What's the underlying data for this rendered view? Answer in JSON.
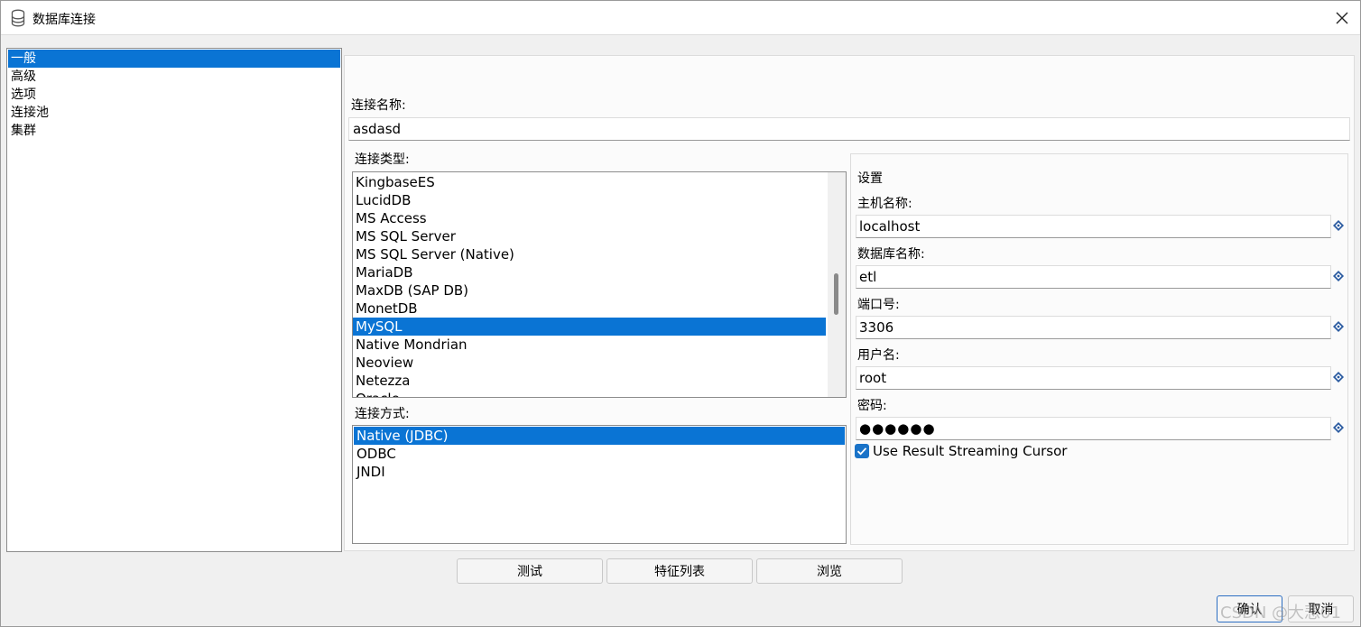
{
  "window": {
    "title": "数据库连接",
    "close_symbol": "✕"
  },
  "nav": {
    "items": [
      {
        "label": "一般",
        "selected": true
      },
      {
        "label": "高级",
        "selected": false
      },
      {
        "label": "选项",
        "selected": false
      },
      {
        "label": "连接池",
        "selected": false
      },
      {
        "label": "集群",
        "selected": false
      }
    ]
  },
  "connection_name": {
    "label": "连接名称:",
    "value": "asdasd"
  },
  "connection_type": {
    "label": "连接类型:",
    "items": [
      {
        "label": "KingbaseES",
        "selected": false
      },
      {
        "label": "LucidDB",
        "selected": false
      },
      {
        "label": "MS Access",
        "selected": false
      },
      {
        "label": "MS SQL Server",
        "selected": false
      },
      {
        "label": "MS SQL Server (Native)",
        "selected": false
      },
      {
        "label": "MariaDB",
        "selected": false
      },
      {
        "label": "MaxDB (SAP DB)",
        "selected": false
      },
      {
        "label": "MonetDB",
        "selected": false
      },
      {
        "label": "MySQL",
        "selected": true
      },
      {
        "label": "Native Mondrian",
        "selected": false
      },
      {
        "label": "Neoview",
        "selected": false
      },
      {
        "label": "Netezza",
        "selected": false
      },
      {
        "label": "Oracle",
        "selected": false
      }
    ]
  },
  "access": {
    "label": "连接方式:",
    "items": [
      {
        "label": "Native (JDBC)",
        "selected": true
      },
      {
        "label": "ODBC",
        "selected": false
      },
      {
        "label": "JNDI",
        "selected": false
      }
    ]
  },
  "settings": {
    "title": "设置",
    "host": {
      "label": "主机名称:",
      "value": "localhost"
    },
    "database": {
      "label": "数据库名称:",
      "value": "etl"
    },
    "port": {
      "label": "端口号:",
      "value": "3306"
    },
    "username": {
      "label": "用户名:",
      "value": "root"
    },
    "password": {
      "label": "密码:",
      "value": "●●●●●●"
    },
    "streaming_cursor": {
      "label": "Use Result Streaming Cursor",
      "checked": true
    }
  },
  "buttons": {
    "test": "测试",
    "features": "特征列表",
    "explore": "浏览",
    "ok": "确认",
    "cancel": "取消"
  },
  "watermark": "CSDN @大悲01",
  "colors": {
    "selection": "#0a74d4",
    "checkbox": "#1a73c8",
    "variable_icon": "#2a5aa0"
  },
  "icons": {
    "title": "database-icon",
    "variable": "variable-diamond-icon",
    "checkbox": "checkmark-icon"
  }
}
